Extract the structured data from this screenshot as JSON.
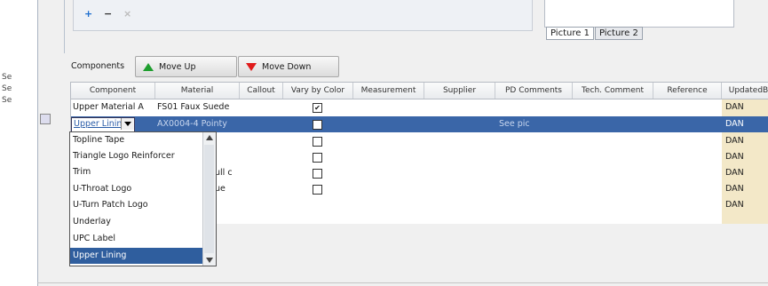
{
  "toolbar": {
    "add_label": "+",
    "remove_label": "−",
    "close_label": "×"
  },
  "picture_tabs": [
    "Picture 1",
    "Picture 2"
  ],
  "left_labels": [
    "Se",
    "Se",
    "Se"
  ],
  "components": {
    "label": "Components",
    "move_up": "Move Up",
    "move_down": "Move Down"
  },
  "columns": [
    "Component",
    "Material",
    "Callout",
    "Vary by Color",
    "Measurement",
    "Supplier",
    "PD Comments",
    "Tech. Comment",
    "Reference",
    "UpdatedB"
  ],
  "rows": [
    {
      "component": "Upper Material A",
      "material": "FS01 Faux Suede",
      "vary": true,
      "pd_comments": "",
      "updated_by": "DAN"
    },
    {
      "component": "Upper Lining",
      "material": "AX0004-4 Pointy",
      "vary": false,
      "pd_comments": "See pic",
      "updated_by": "DAN"
    },
    {
      "component": "",
      "material": "",
      "vary": false,
      "pd_comments": "",
      "updated_by": "DAN"
    },
    {
      "component": "",
      "material": "",
      "vary": false,
      "pd_comments": "",
      "updated_by": "DAN"
    },
    {
      "component": "",
      "material": "ull c",
      "vary": false,
      "pd_comments": "",
      "updated_by": "DAN"
    },
    {
      "component": "",
      "material": "ue",
      "vary": false,
      "pd_comments": "",
      "updated_by": "DAN"
    },
    {
      "component": "",
      "material": "",
      "vary": false,
      "pd_comments": "",
      "updated_by": "DAN"
    }
  ],
  "dropdown": {
    "items": [
      "Topline Tape",
      "Triangle Logo Reinforcer",
      "Trim",
      "U-Throat Logo",
      "U-Turn Patch Logo",
      "Underlay",
      "UPC Label",
      "Upper Lining"
    ],
    "selected": "Upper Lining"
  },
  "colors": {
    "selection": "#3a66a8",
    "move_up_icon": "#1e9e2e",
    "move_down_icon": "#e01b1b",
    "updated_col": "#f3e8c8"
  }
}
